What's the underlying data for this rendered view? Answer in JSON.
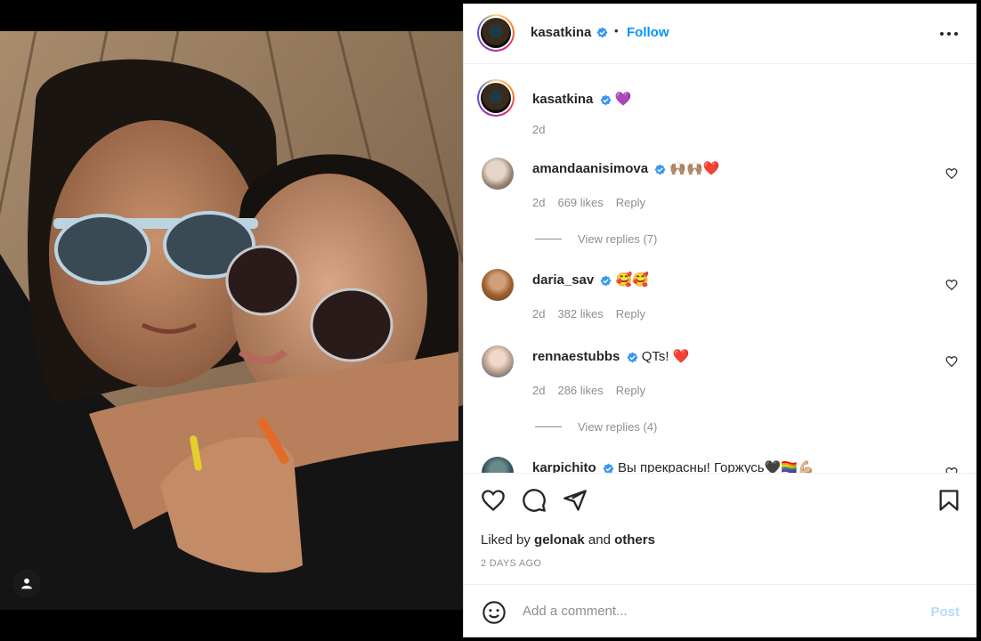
{
  "post": {
    "author": "kasatkina",
    "follow_label": "Follow",
    "separator": "•",
    "caption_emoji": "💜",
    "caption_time": "2d"
  },
  "comments": [
    {
      "user": "amandaanisimova",
      "text": "🙌🏽🙌🏽❤️",
      "time": "2d",
      "likes": "669 likes",
      "reply": "Reply",
      "view_replies": "View replies (7)"
    },
    {
      "user": "daria_sav",
      "text": "🥰🥰",
      "time": "2d",
      "likes": "382 likes",
      "reply": "Reply"
    },
    {
      "user": "rennaestubbs",
      "text": "QTs! ❤️",
      "time": "2d",
      "likes": "286 likes",
      "reply": "Reply",
      "view_replies": "View replies (4)"
    },
    {
      "user": "karpichito",
      "text": "Вы прекрасны! Горжусь🖤🏳️‍🌈💪🏼"
    }
  ],
  "footer": {
    "liked_prefix": "Liked by",
    "liked_user": "gelonak",
    "liked_and": "and",
    "liked_others": "others",
    "time_ago": "2 DAYS AGO",
    "comment_placeholder": "Add a comment...",
    "post_label": "Post"
  },
  "colors": {
    "link_blue": "#0095f6",
    "post_disabled": "#b3dbff",
    "muted": "#8e8e8e",
    "verified": "#3897f0"
  },
  "icons": [
    "user-tag-icon",
    "more-options-icon",
    "verified-badge-icon",
    "heart-icon",
    "comment-icon",
    "share-icon",
    "save-icon",
    "emoji-icon"
  ]
}
